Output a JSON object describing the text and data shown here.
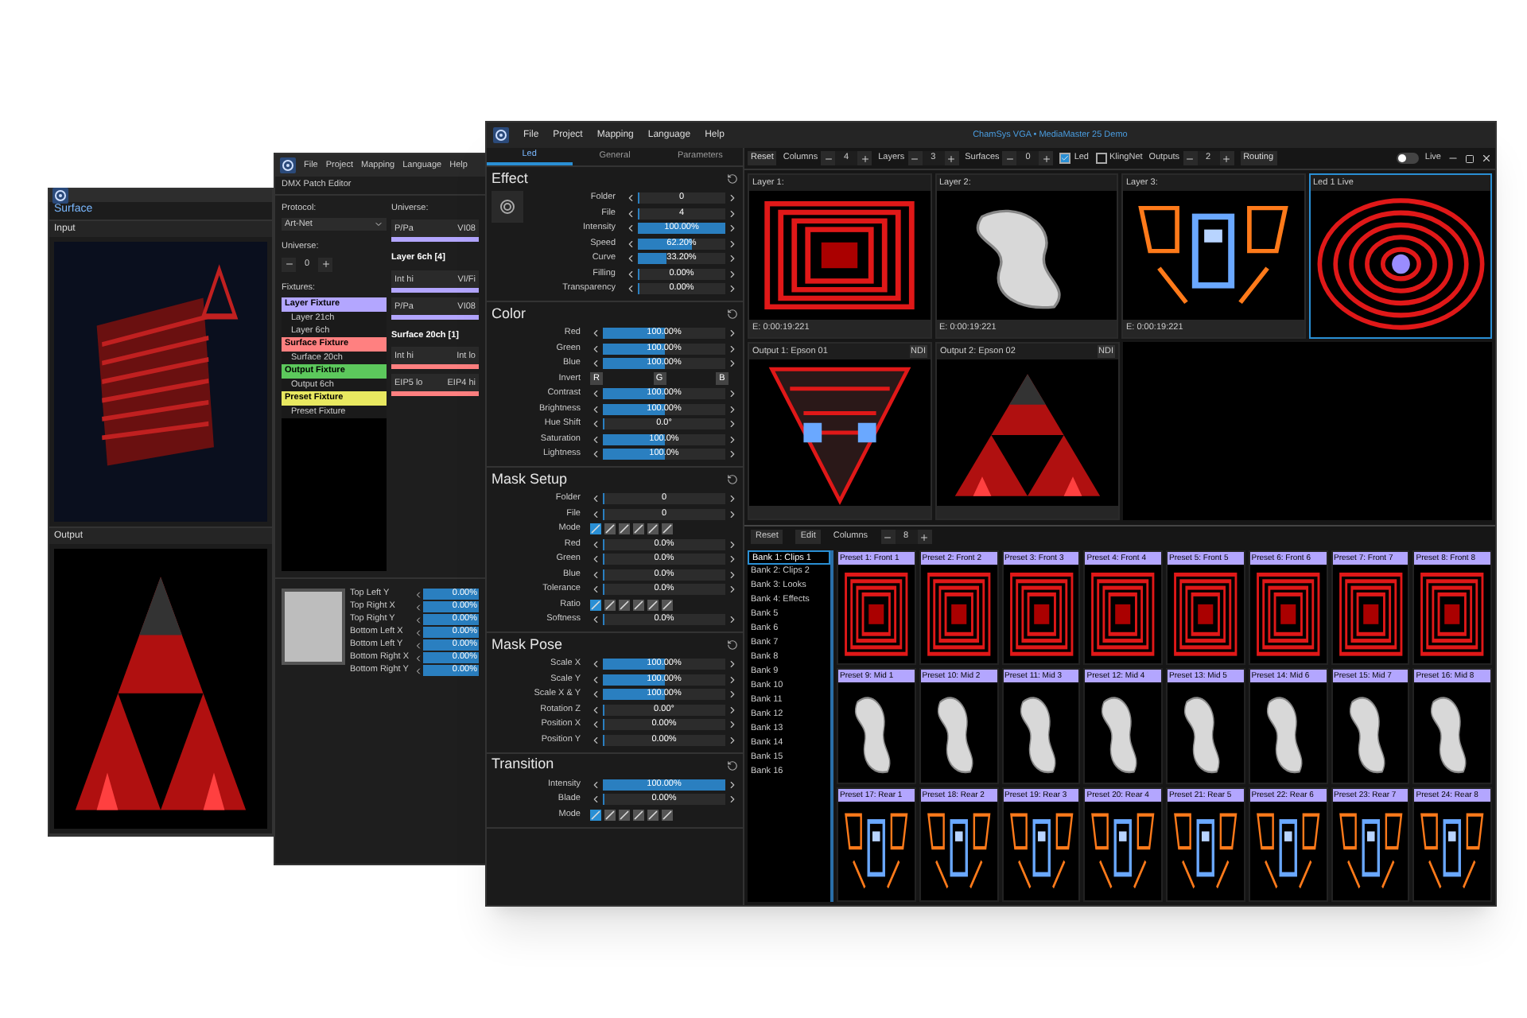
{
  "back_window": {
    "surface_title": "Surface",
    "sections": [
      {
        "title": "Input",
        "kind": "input"
      },
      {
        "title": "Output",
        "kind": "output"
      }
    ]
  },
  "middle_window": {
    "menu": [
      "File",
      "Project",
      "Mapping",
      "Language",
      "Help"
    ],
    "title": "DMX Patch Editor",
    "protocol_label": "Protocol:",
    "protocol": "Art-Net",
    "universe_label": "Universe:",
    "universe": "0",
    "fixtures_label": "Fixtures:",
    "fixtures": [
      {
        "label": "Layer Fixture",
        "color": "#b3a6ff",
        "children": [
          {
            "label": "Layer 21ch"
          },
          {
            "label": "Layer 6ch"
          }
        ]
      },
      {
        "label": "Surface Fixture",
        "color": "#ff8080",
        "children": [
          {
            "label": "Surface 20ch"
          }
        ]
      },
      {
        "label": "Output Fixture",
        "color": "#5cc85c",
        "children": [
          {
            "label": "Output 6ch"
          }
        ]
      },
      {
        "label": "Preset Fixture",
        "color": "#e8e860",
        "children": [
          {
            "label": "Preset Fixture"
          }
        ]
      }
    ],
    "universe_title": "Universe:",
    "universe_map": [
      {
        "kind": "cell",
        "left": "P/Pa",
        "right": "VI08",
        "color": "#b3a6ff"
      },
      {
        "kind": "heading",
        "text": "Layer 6ch [4]"
      },
      {
        "kind": "cell",
        "left": "Int hi",
        "right": "VI/Fi",
        "color": "#b3a6ff"
      },
      {
        "kind": "cell",
        "left": "P/Pa",
        "right": "VI08",
        "color": "#b3a6ff"
      },
      {
        "kind": "heading",
        "text": "Surface 20ch [1]"
      },
      {
        "kind": "cell",
        "left": "Int hi",
        "right": "Int lo",
        "color": "#ff8080"
      },
      {
        "kind": "cell",
        "left": "EIP5 lo",
        "right": "EIP4 hi",
        "color": "#ff8080"
      }
    ],
    "corners": [
      {
        "label": "Top Left Y",
        "value": "0.00%"
      },
      {
        "label": "Top Right X",
        "value": "0.00%"
      },
      {
        "label": "Top Right Y",
        "value": "0.00%"
      },
      {
        "label": "Bottom Left X",
        "value": "0.00%"
      },
      {
        "label": "Bottom Left Y",
        "value": "0.00%"
      },
      {
        "label": "Bottom Right X",
        "value": "0.00%"
      },
      {
        "label": "Bottom Right Y",
        "value": "0.00%"
      }
    ]
  },
  "window": {
    "menu": [
      "File",
      "Project",
      "Mapping",
      "Language",
      "Help"
    ],
    "title": "ChamSys VGA • MediaMaster 25 Demo"
  },
  "tabs": [
    {
      "label": "Led",
      "selected": true
    },
    {
      "label": "General",
      "selected": false
    },
    {
      "label": "Parameters",
      "selected": false
    }
  ],
  "sections": [
    {
      "title": "Effect",
      "rows": [
        {
          "kind": "slider",
          "label": "Folder",
          "reading": "0",
          "level": 0
        },
        {
          "kind": "slider",
          "label": "File",
          "reading": "4",
          "level": 0.02
        },
        {
          "kind": "slider",
          "label": "Intensity",
          "reading": "100.00%",
          "level": 1
        },
        {
          "kind": "slider",
          "label": "Speed",
          "reading": "62.20%",
          "level": 0.62
        },
        {
          "kind": "slider",
          "label": "Curve",
          "reading": "33.20%",
          "level": 0.33
        },
        {
          "kind": "slider",
          "label": "Filling",
          "reading": "0.00%",
          "level": 0
        },
        {
          "kind": "slider",
          "label": "Transparency",
          "reading": "0.00%",
          "level": 0
        }
      ]
    },
    {
      "title": "Color",
      "rows": [
        {
          "kind": "slider",
          "label": "Red",
          "reading": "100.00%",
          "level": 0.5
        },
        {
          "kind": "slider",
          "label": "Green",
          "reading": "100.00%",
          "level": 0.5
        },
        {
          "kind": "slider",
          "label": "Blue",
          "reading": "100.00%",
          "level": 0.5
        },
        {
          "kind": "rgb",
          "label": "Invert",
          "buttons": [
            "R",
            "G",
            "B"
          ]
        },
        {
          "kind": "slider",
          "label": "Contrast",
          "reading": "100.00%",
          "level": 0.5
        },
        {
          "kind": "slider",
          "label": "Brightness",
          "reading": "100.00%",
          "level": 0.5
        },
        {
          "kind": "slider",
          "label": "Hue Shift",
          "reading": "0.0°",
          "level": 0
        },
        {
          "kind": "slider",
          "label": "Saturation",
          "reading": "100.0%",
          "level": 0.5
        },
        {
          "kind": "slider",
          "label": "Lightness",
          "reading": "100.0%",
          "level": 0.5
        }
      ]
    },
    {
      "title": "Mask Setup",
      "rows": [
        {
          "kind": "slider",
          "label": "Folder",
          "reading": "0",
          "level": 0
        },
        {
          "kind": "slider",
          "label": "File",
          "reading": "0",
          "level": 0
        },
        {
          "kind": "modes",
          "label": "Mode"
        },
        {
          "kind": "slider",
          "label": "Red",
          "reading": "0.0%",
          "level": 0
        },
        {
          "kind": "slider",
          "label": "Green",
          "reading": "0.0%",
          "level": 0
        },
        {
          "kind": "slider",
          "label": "Blue",
          "reading": "0.0%",
          "level": 0
        },
        {
          "kind": "slider",
          "label": "Tolerance",
          "reading": "0.0%",
          "level": 0
        },
        {
          "kind": "modes",
          "label": "Ratio"
        },
        {
          "kind": "slider",
          "label": "Softness",
          "reading": "0.0%",
          "level": 0
        }
      ]
    },
    {
      "title": "Mask Pose",
      "rows": [
        {
          "kind": "slider",
          "label": "Scale X",
          "reading": "100.00%",
          "level": 0.5
        },
        {
          "kind": "slider",
          "label": "Scale Y",
          "reading": "100.00%",
          "level": 0.5
        },
        {
          "kind": "slider",
          "label": "Scale X & Y",
          "reading": "100.00%",
          "level": 0.5
        },
        {
          "kind": "slider",
          "label": "Rotation Z",
          "reading": "0.00°",
          "level": 0
        },
        {
          "kind": "slider",
          "label": "Position X",
          "reading": "0.00%",
          "level": 0
        },
        {
          "kind": "slider",
          "label": "Position Y",
          "reading": "0.00%",
          "level": 0
        }
      ]
    },
    {
      "title": "Transition",
      "rows": [
        {
          "kind": "slider",
          "label": "Intensity",
          "reading": "100.00%",
          "level": 1
        },
        {
          "kind": "slider",
          "label": "Blade",
          "reading": "0.00%",
          "level": 0
        },
        {
          "kind": "modes",
          "label": "Mode"
        }
      ]
    }
  ],
  "toolbar": [
    {
      "kind": "button",
      "label": "Reset"
    },
    {
      "kind": "stepper",
      "label": "Columns",
      "value": "4"
    },
    {
      "kind": "stepper",
      "label": "Layers",
      "value": "3"
    },
    {
      "kind": "stepper",
      "label": "Surfaces",
      "value": "0"
    },
    {
      "kind": "checkbox",
      "label": "Led",
      "checked": true
    },
    {
      "kind": "checkbox",
      "label": "KlingNet",
      "checked": false
    },
    {
      "kind": "stepper",
      "label": "Outputs",
      "value": "2"
    },
    {
      "kind": "button",
      "label": "Routing"
    }
  ],
  "live_toggle": {
    "label": "Live",
    "on": false
  },
  "layers": [
    {
      "title": "Layer 1:",
      "time": "E: 0:00:19:221",
      "kind": "squares",
      "selected": false
    },
    {
      "title": "Layer 2:",
      "time": "E: 0:00:19:221",
      "kind": "waves",
      "selected": false
    },
    {
      "title": "Layer 3:",
      "time": "E: 0:00:19:221",
      "kind": "tunnel",
      "selected": false
    },
    {
      "title": "Led 1 Live",
      "kind": "rings",
      "selected": true
    }
  ],
  "outputs": [
    {
      "title": "Output 1: Epson 01",
      "badge": "NDI",
      "kind": "inverted"
    },
    {
      "title": "Output 2: Epson 02",
      "badge": "NDI",
      "kind": "triangle"
    }
  ],
  "bank_toolbar": {
    "reset": "Reset",
    "edit": "Edit",
    "columns_label": "Columns",
    "columns": "8"
  },
  "banks": [
    {
      "label": "Bank 1: Clips 1",
      "selected": true
    },
    {
      "label": "Bank 2: Clips 2",
      "selected": false
    },
    {
      "label": "Bank 3: Looks",
      "selected": false
    },
    {
      "label": "Bank 4: Effects",
      "selected": false
    },
    {
      "label": "Bank 5",
      "selected": false
    },
    {
      "label": "Bank 6",
      "selected": false
    },
    {
      "label": "Bank 7",
      "selected": false
    },
    {
      "label": "Bank 8",
      "selected": false
    },
    {
      "label": "Bank 9",
      "selected": false
    },
    {
      "label": "Bank 10",
      "selected": false
    },
    {
      "label": "Bank 11",
      "selected": false
    },
    {
      "label": "Bank 12",
      "selected": false
    },
    {
      "label": "Bank 13",
      "selected": false
    },
    {
      "label": "Bank 14",
      "selected": false
    },
    {
      "label": "Bank 15",
      "selected": false
    },
    {
      "label": "Bank 16",
      "selected": false
    }
  ],
  "presets": [
    {
      "label": "Preset 1: Front 1",
      "kind": "front"
    },
    {
      "label": "Preset 2: Front 2",
      "kind": "front"
    },
    {
      "label": "Preset 3: Front 3",
      "kind": "front"
    },
    {
      "label": "Preset 4: Front 4",
      "kind": "front"
    },
    {
      "label": "Preset 5: Front 5",
      "kind": "front"
    },
    {
      "label": "Preset 6: Front 6",
      "kind": "front"
    },
    {
      "label": "Preset 7: Front 7",
      "kind": "front"
    },
    {
      "label": "Preset 8: Front 8",
      "kind": "front"
    },
    {
      "label": "Preset 9: Mid 1",
      "kind": "mid"
    },
    {
      "label": "Preset 10: Mid 2",
      "kind": "mid"
    },
    {
      "label": "Preset 11: Mid 3",
      "kind": "mid"
    },
    {
      "label": "Preset 12: Mid 4",
      "kind": "mid"
    },
    {
      "label": "Preset 13: Mid 5",
      "kind": "mid"
    },
    {
      "label": "Preset 14: Mid 6",
      "kind": "mid"
    },
    {
      "label": "Preset 15: Mid 7",
      "kind": "mid"
    },
    {
      "label": "Preset 16: Mid 8",
      "kind": "mid"
    },
    {
      "label": "Preset 17: Rear 1",
      "kind": "rear"
    },
    {
      "label": "Preset 18: Rear 2",
      "kind": "rear"
    },
    {
      "label": "Preset 19: Rear 3",
      "kind": "rear"
    },
    {
      "label": "Preset 20: Rear 4",
      "kind": "rear"
    },
    {
      "label": "Preset 21: Rear 5",
      "kind": "rear"
    },
    {
      "label": "Preset 22: Rear 6",
      "kind": "rear"
    },
    {
      "label": "Preset 23: Rear 7",
      "kind": "rear"
    },
    {
      "label": "Preset 24: Rear 8",
      "kind": "rear"
    }
  ]
}
